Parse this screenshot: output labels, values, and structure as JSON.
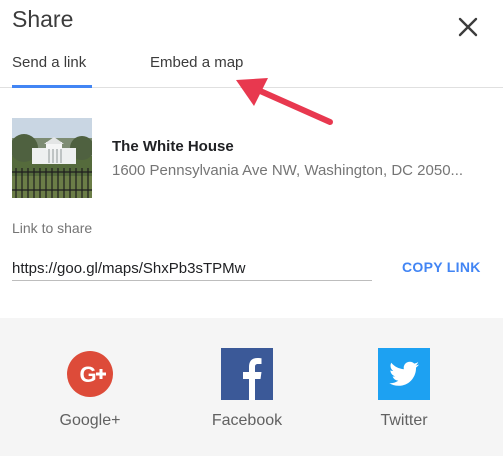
{
  "dialog": {
    "title": "Share"
  },
  "tabs": [
    {
      "label": "Send a link",
      "active": true
    },
    {
      "label": "Embed a map",
      "active": false
    }
  ],
  "place": {
    "name": "The White House",
    "address": "1600 Pennsylvania Ave NW, Washington, DC 2050..."
  },
  "link": {
    "label": "Link to share",
    "value": "https://goo.gl/maps/ShxPb3sTPMw",
    "copy_label": "COPY LINK"
  },
  "social": [
    {
      "label": "Google+",
      "icon": "google-plus-icon",
      "color": "#dd4b39"
    },
    {
      "label": "Facebook",
      "icon": "facebook-icon",
      "color": "#3b5998"
    },
    {
      "label": "Twitter",
      "icon": "twitter-icon",
      "color": "#1da1f2"
    }
  ],
  "colors": {
    "accent": "#4285f4",
    "annotation_arrow": "#e8384f"
  }
}
